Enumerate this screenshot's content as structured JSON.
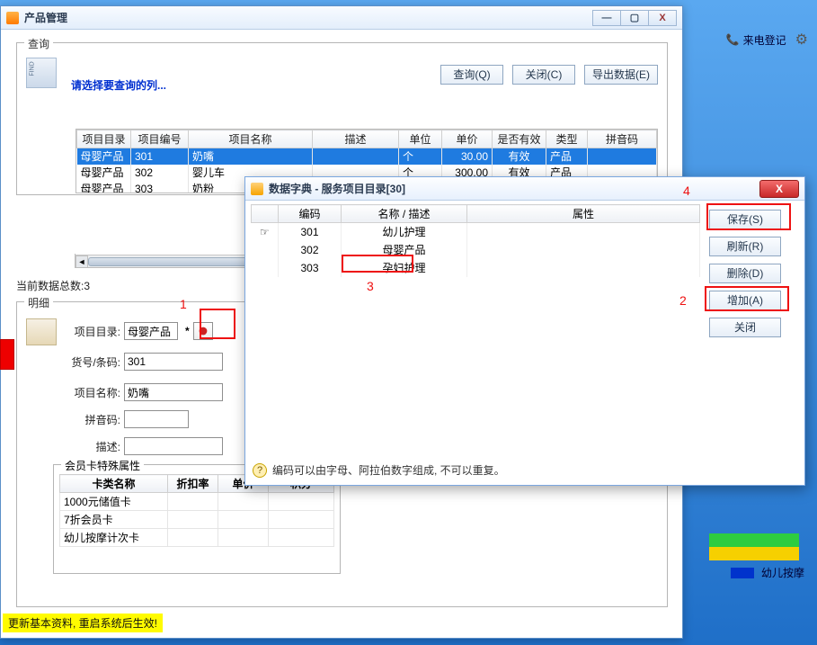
{
  "main": {
    "title": "产品管理",
    "win_min": "—",
    "win_max": "▢",
    "win_close": "X",
    "query": {
      "legend": "查询",
      "prompt": "请选择要查询的列...",
      "btn_query": "查询(Q)",
      "btn_close": "关闭(C)",
      "btn_export": "导出数据(E)"
    },
    "cols": {
      "c1": "项目目录",
      "c2": "项目编号",
      "c3": "项目名称",
      "c4": "描述",
      "c5": "单位",
      "c6": "单价",
      "c7": "是否有效",
      "c8": "类型",
      "c9": "拼音码"
    },
    "rows": {
      "r0": {
        "c1": "母婴产品",
        "c2": "301",
        "c3": "奶嘴",
        "c4": "",
        "c5": "个",
        "c6": "30.00",
        "c7": "有效",
        "c8": "产品",
        "c9": ""
      },
      "r1": {
        "c1": "母婴产品",
        "c2": "302",
        "c3": "婴儿车",
        "c4": "",
        "c5": "个",
        "c6": "300.00",
        "c7": "有效",
        "c8": "产品",
        "c9": ""
      },
      "r2": {
        "c1": "母婴产品",
        "c2": "303",
        "c3": "奶粉",
        "c4": "",
        "c5": "",
        "c6": "",
        "c7": "",
        "c8": "",
        "c9": ""
      }
    },
    "total": "当前数据总数:3",
    "detail": {
      "legend": "明细",
      "l_category": "项目目录:",
      "v_category": "母婴产品",
      "req": "*",
      "l_code": "货号/条码:",
      "v_code": "301",
      "l_name": "项目名称:",
      "v_name": "奶嘴",
      "l_pinyin": "拼音码:",
      "v_pinyin": "",
      "l_desc": "描述:",
      "v_desc": ""
    },
    "card": {
      "legend": "会员卡特殊属性",
      "h1": "卡类名称",
      "h2": "折扣率",
      "h3": "单价",
      "h4": "积分",
      "r0": "1000元储值卡",
      "r1": "7折会员卡",
      "r2": "幼儿按摩计次卡"
    },
    "status": "更新基本资料, 重启系统后生效!"
  },
  "dlg": {
    "title": "数据字典 - 服务项目目录[30]",
    "cols": {
      "c1": "编码",
      "c2": "名称 / 描述",
      "c3": "属性"
    },
    "rows": {
      "r0": {
        "c1": "301",
        "c2": "幼儿护理"
      },
      "r1": {
        "c1": "302",
        "c2": "母婴产品"
      },
      "r2": {
        "c1": "303",
        "c2": "孕妇护理"
      }
    },
    "btns": {
      "save": "保存(S)",
      "refresh": "刷新(R)",
      "delete": "删除(D)",
      "add": "增加(A)",
      "close": "关闭"
    },
    "hint": "编码可以由字母、阿拉伯数字组成, 不可以重复。"
  },
  "side": {
    "caller": "来电登记",
    "legend_label": "幼儿按摩"
  },
  "marks": {
    "m1": "1",
    "m2": "2",
    "m3": "3",
    "m4": "4"
  }
}
